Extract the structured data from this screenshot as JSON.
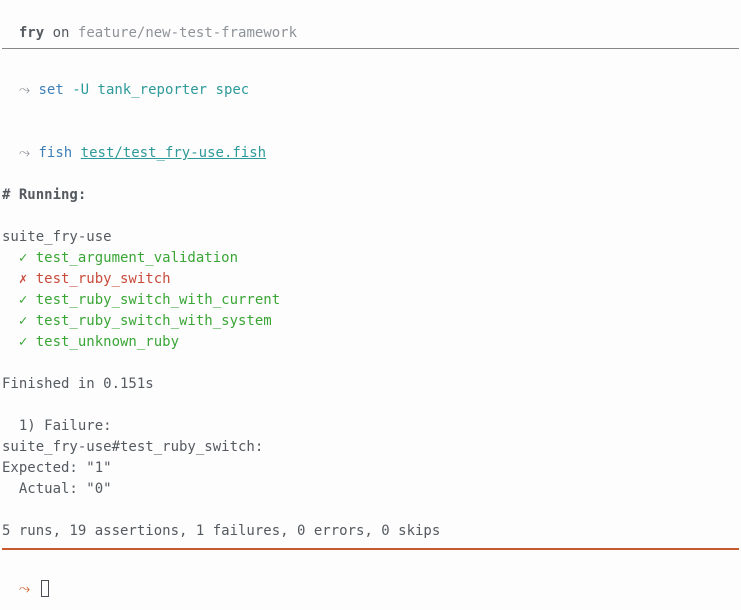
{
  "header": {
    "user": "fry",
    "on": "on",
    "branch": "feature/new-test-framework"
  },
  "cmd1": {
    "arrow": "⤳",
    "name": "set",
    "args": "-U tank_reporter spec"
  },
  "cmd2": {
    "arrow": "⤳",
    "name": "fish",
    "arg": "test/test_fry-use.fish"
  },
  "output": {
    "running_header": "# Running:",
    "suite_name": "suite_fry-use",
    "tests": [
      {
        "mark": "✓",
        "name": "test_argument_validation",
        "status": "pass"
      },
      {
        "mark": "✗",
        "name": "test_ruby_switch",
        "status": "fail"
      },
      {
        "mark": "✓",
        "name": "test_ruby_switch_with_current",
        "status": "pass"
      },
      {
        "mark": "✓",
        "name": "test_ruby_switch_with_system",
        "status": "pass"
      },
      {
        "mark": "✓",
        "name": "test_unknown_ruby",
        "status": "pass"
      }
    ],
    "finished": "Finished in 0.151s",
    "failure_header": "  1) Failure:",
    "failure_location": "suite_fry-use#test_ruby_switch:",
    "expected": "Expected: \"1\"",
    "actual": "  Actual: \"0\"",
    "summary": "5 runs, 19 assertions, 1 failures, 0 errors, 0 skips"
  },
  "prompt": {
    "arrow": "⤳"
  }
}
